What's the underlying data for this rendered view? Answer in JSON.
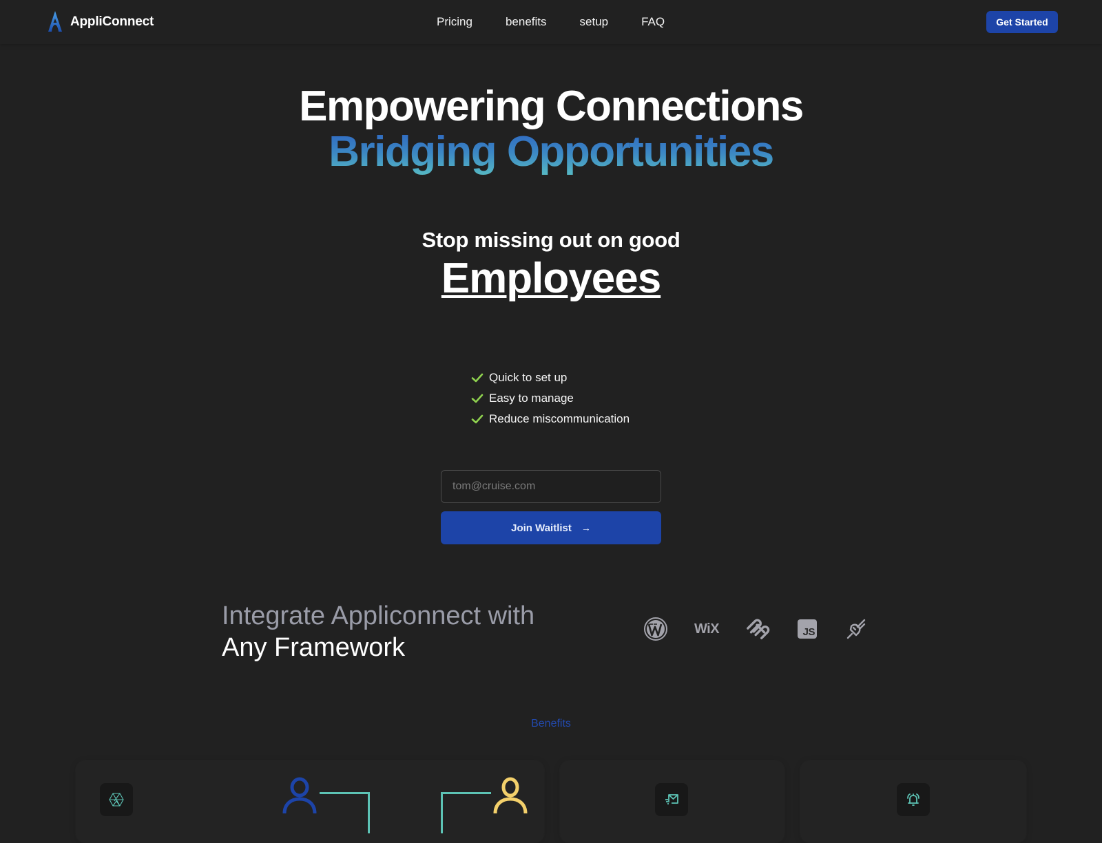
{
  "navbar": {
    "brand_name": "AppliConnect",
    "brand_icon": "appliconnect-logo-icon",
    "links": [
      {
        "label": "Pricing"
      },
      {
        "label": "benefits"
      },
      {
        "label": "setup"
      },
      {
        "label": "FAQ"
      }
    ],
    "cta_label": "Get Started"
  },
  "hero": {
    "title_line1": "Empowering Connections",
    "title_line2": "Bridging Opportunities",
    "subtitle": "Stop missing out on good",
    "subtitle_highlight": "Employees",
    "features": [
      {
        "icon": "check-icon",
        "label": "Quick to set up"
      },
      {
        "icon": "check-icon",
        "label": "Easy to manage"
      },
      {
        "icon": "check-icon",
        "label": "Reduce miscommunication"
      }
    ],
    "email_placeholder": "tom@cruise.com",
    "email_value": "",
    "join_label": "Join Waitlist",
    "join_icon": "arrow-right-icon"
  },
  "integrations": {
    "heading_line1": "Integrate Appliconnect with",
    "heading_line2": "Any Framework",
    "logos": [
      {
        "name": "wordpress-icon"
      },
      {
        "name": "wix-icon",
        "text": "WiX"
      },
      {
        "name": "squarespace-icon"
      },
      {
        "name": "javascript-icon",
        "text": "JS"
      },
      {
        "name": "plug-icon"
      }
    ]
  },
  "benefits": {
    "section_label": "Benefits",
    "cards": [
      {
        "icon": "polyhedron-icon"
      },
      {
        "icon": "mail-send-icon"
      },
      {
        "icon": "bell-ringing-icon"
      }
    ]
  },
  "colors": {
    "background": "#212121",
    "accent_blue": "#1d44a8",
    "gradient_start": "#2e65c0",
    "gradient_end": "#56b8c4",
    "check_green": "#8fd14f",
    "teal": "#5dc3b5",
    "person_yellow": "#f3d06b"
  }
}
